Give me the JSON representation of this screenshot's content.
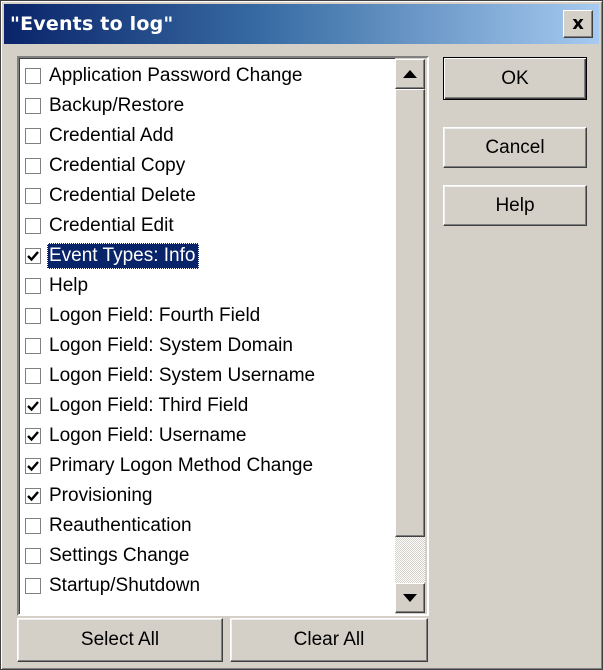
{
  "dialog": {
    "title": "\"Events to log\"",
    "close_label": "x"
  },
  "events": [
    {
      "label": "Application Password Change",
      "checked": false
    },
    {
      "label": "Backup/Restore",
      "checked": false
    },
    {
      "label": "Credential Add",
      "checked": false
    },
    {
      "label": "Credential Copy",
      "checked": false
    },
    {
      "label": "Credential Delete",
      "checked": false
    },
    {
      "label": "Credential Edit",
      "checked": false
    },
    {
      "label": "Event Types: Info",
      "checked": true
    },
    {
      "label": "Help",
      "checked": false
    },
    {
      "label": "Logon Field: Fourth Field",
      "checked": false
    },
    {
      "label": "Logon Field: System Domain",
      "checked": false
    },
    {
      "label": "Logon Field:  System Username",
      "checked": false
    },
    {
      "label": "Logon Field: Third Field",
      "checked": true
    },
    {
      "label": "Logon Field: Username",
      "checked": true
    },
    {
      "label": "Primary Logon Method Change",
      "checked": true
    },
    {
      "label": "Provisioning",
      "checked": true
    },
    {
      "label": "Reauthentication",
      "checked": false
    },
    {
      "label": "Settings Change",
      "checked": false
    },
    {
      "label": "Startup/Shutdown",
      "checked": false
    }
  ],
  "selected_event": "Event Types: Info",
  "buttons": {
    "ok": "OK",
    "cancel": "Cancel",
    "help": "Help",
    "select_all": "Select All",
    "clear_all": "Clear All"
  },
  "icons": {
    "close": "close-icon",
    "scroll_up": "scroll-up-arrow-icon",
    "scroll_down": "scroll-down-arrow-icon",
    "checkmark": "checkmark-icon"
  },
  "colors": {
    "selection": "#0a246a",
    "face": "#d4d0c8"
  }
}
